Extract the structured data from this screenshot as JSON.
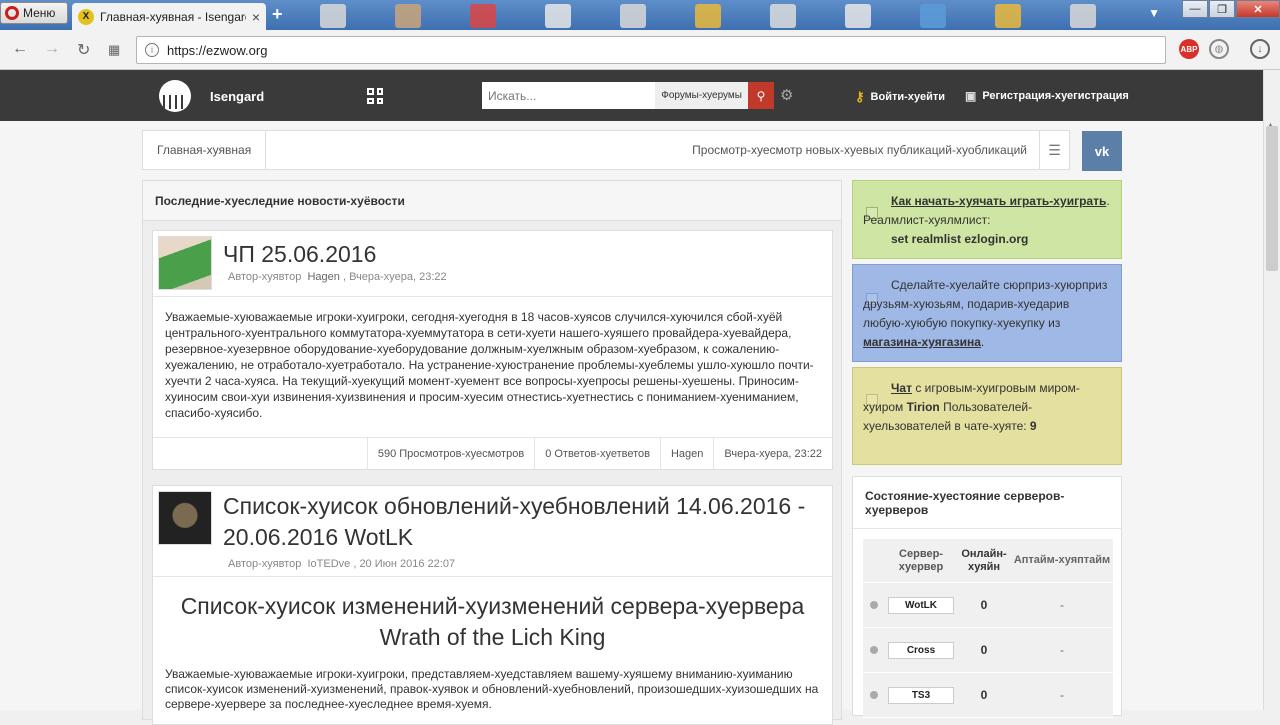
{
  "browser": {
    "menu_label": "Меню",
    "tab_title": "Главная-хуявная - Isengard",
    "tab_close": "×",
    "new_tab": "+",
    "url": "https://ezwow.org",
    "window_controls": {
      "minimize": "—",
      "maximize": "❐",
      "close": "✕"
    }
  },
  "site": {
    "brand": "Isengard",
    "search_placeholder": "Искать...",
    "search_scope": "Форумы-хуерумы",
    "login": "Войти-хуейти",
    "register": "Регистрация-хуегистрация"
  },
  "breadcrumb": {
    "home": "Главная-хуявная",
    "recent": "Просмотр-хуесмотр новых-хуевых публикаций-хуобликаций",
    "vk": "vk"
  },
  "news": {
    "header": "Последние-хуеследние новости-хуёвости",
    "posts": [
      {
        "title": "ЧП 25.06.2016",
        "author_label": "Автор-хуявтор",
        "author": "Hagen",
        "date": ", Вчера-хуера, 23:22",
        "body": "Уважаемые-хуюважаемые игроки-хуигроки, сегодня-хуегодня в 18 часов-хуясов случился-хуючился сбой-хуёй центрального-хуентрального коммутатора-хуеммутатора в сети-хуети нашего-хуяшего провайдера-хуевайдера, резервное-хуезервное оборудование-хуеборудование должным-хуелжным образом-хуебразом, к сожалению-хуежалению, не отработало-хуетработало. На устранение-хуюстранение проблемы-хуеблемы ушло-хуюшло почти-хуечти 2 часа-хуяса. На текущий-хуекущий момент-хуемент все вопросы-хуепросы решены-хуешены. Приносим-хуиносим свои-хуи извинения-хуизвинения и просим-хуесим отнестись-хуетнестись с пониманием-хуениманием, спасибо-хуясибо.",
        "views": "590 Просмотров-хуесмотров",
        "replies": "0 Ответов-хуетветов",
        "last_author": "Hagen",
        "last_date": "Вчера-хуера, 23:22"
      },
      {
        "title": "Список-хуисок обновлений-хуебновлений 14.06.2016 - 20.06.2016 WotLK",
        "author_label": "Автор-хуявтор",
        "author": "IoTEDve",
        "date": ", 20 Июн 2016 22:07",
        "heading": "Список-хуисок изменений-хуизменений сервера-хуервера Wrath of the Lich King",
        "body": "Уважаемые-хуюважаемые игроки-хуигроки, представляем-хуедставляем вашему-хуяшему вниманию-хуиманию список-хуисок изменений-хуизменений, правок-хуявок и обновлений-хуебновлений, произошедших-хуизошедших на сервере-хуервере за последнее-хуеследнее время-хуемя."
      }
    ]
  },
  "sidebar": {
    "box1": {
      "link": "Как начать-хуячать играть-хуиграть",
      "text": ". Реалмлист-хуялмлист:",
      "realmlist": "set realmlist ezlogin.org"
    },
    "box2": {
      "text": "Сделайте-хуелайте сюрприз-хуюрприз друзьям-хуюзьям, подарив-хуедарив любую-хуюбую покупку-хуекупку из",
      "link": "магазина-хуягазина",
      "end": "."
    },
    "box3": {
      "link": "Чат",
      "text1": " с игровым-хуигровым миром-хуиром ",
      "server": "Tirion",
      "text2": " Пользователей-хуельзователей в чате-хуяте: ",
      "count": "9"
    },
    "servers": {
      "header": "Состояние-хуестояние серверов-хуерверов",
      "col_server": "Сервер-хуервер",
      "col_online": "Онлайн-хуяйн",
      "col_uptime": "Аптайм-хуяптайм",
      "rows": [
        {
          "name": "WotLK",
          "online": "0",
          "uptime": "-"
        },
        {
          "name": "Cross",
          "online": "0",
          "uptime": "-"
        },
        {
          "name": "TS3",
          "online": "0",
          "uptime": "-"
        }
      ]
    }
  },
  "colors": {
    "header_bg": "#3a3a3a",
    "search_btn": "#c0392b",
    "vk": "#5b7fa6",
    "box_green": "#cfe5a3",
    "box_blue": "#9fb8e6",
    "box_yellow": "#e3e0a0"
  }
}
